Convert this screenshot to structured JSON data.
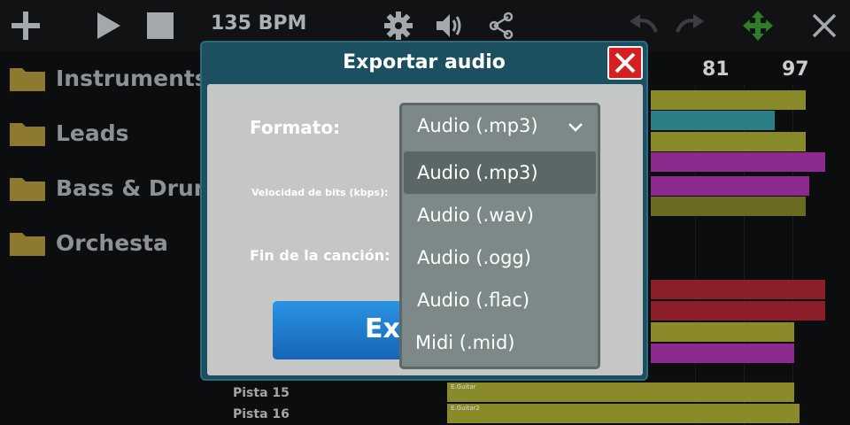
{
  "toolbar": {
    "bpm": "135 BPM",
    "icons": [
      "plus-icon",
      "play-icon",
      "stop-icon",
      "gear-icon",
      "speaker-icon",
      "share-icon",
      "undo-icon",
      "redo-icon",
      "move-icon",
      "close-icon"
    ]
  },
  "ruler": {
    "marks": [
      "81",
      "97"
    ]
  },
  "library": {
    "items": [
      {
        "label": "Instruments"
      },
      {
        "label": "Leads"
      },
      {
        "label": "Bass & Drums"
      },
      {
        "label": "Orchesta"
      }
    ]
  },
  "tracks": {
    "labels": [
      "Pista 15",
      "Pista 16"
    ],
    "clip_labels": [
      "E.Guitar",
      "E.Guitar2"
    ]
  },
  "dialog": {
    "title": "Exportar audio",
    "format_label": "Formato:",
    "bitrate_label": "Velocidad de bits (kbps):",
    "end_label": "Fin de la canción:",
    "export_button": "Exp",
    "format": {
      "selected": "Audio (.mp3)",
      "options": [
        "Audio (.mp3)",
        "Audio (.wav)",
        "Audio (.ogg)",
        "Audio (.flac)",
        "Midi (.mid)"
      ]
    }
  },
  "colors": {
    "dialog_header": "#1c4f5f",
    "dialog_body": "#c5c6c6",
    "close_button": "#d42020",
    "export_button": "#1f7fd2",
    "dropdown": "#7d8988",
    "folder": "#8e7a2e",
    "move_icon": "#2f7d2a"
  }
}
